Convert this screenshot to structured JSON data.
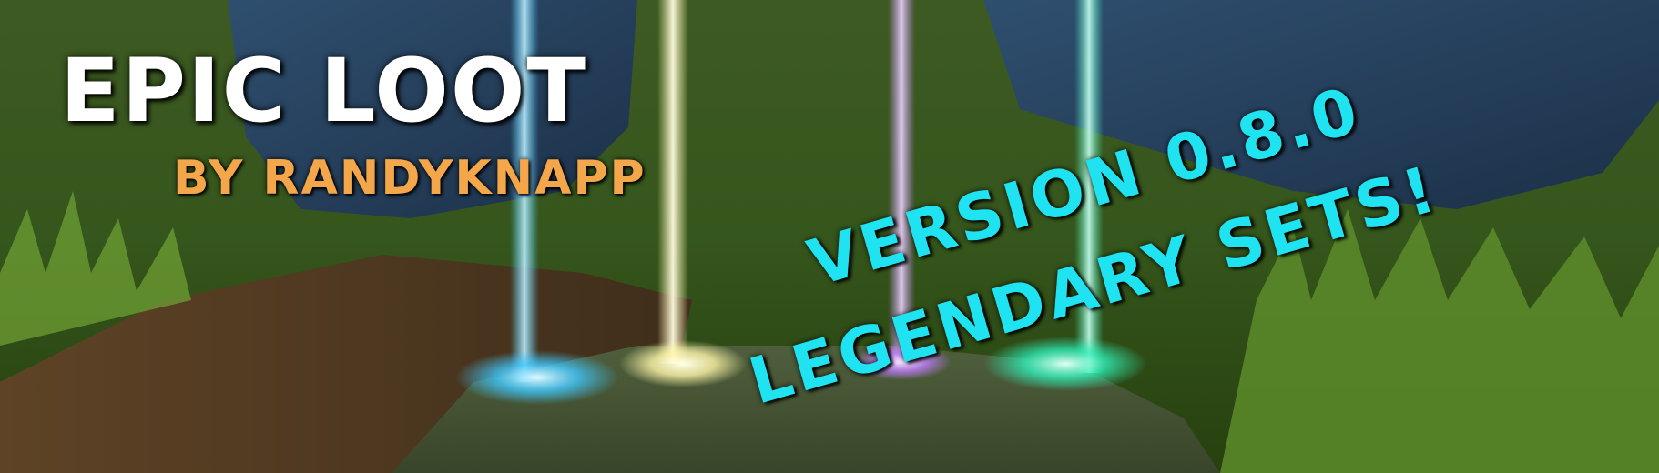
{
  "banner": {
    "title": "EPIC LOOT",
    "subtitle": "BY RANDYKNAPP",
    "headline_line1": "VERSION 0.8.0",
    "headline_line2": "LEGENDARY SETS!"
  },
  "colors": {
    "title": "#ffffff",
    "subtitle": "#f4a64a",
    "headline": "#1fe3f0",
    "beam_blue": "#3fc8ff",
    "beam_yellow": "#fff6a8",
    "beam_purple": "#c27dff",
    "beam_teal": "#2ff0b8",
    "grass": "#4f7a26",
    "rock": "#2e4a6a"
  }
}
